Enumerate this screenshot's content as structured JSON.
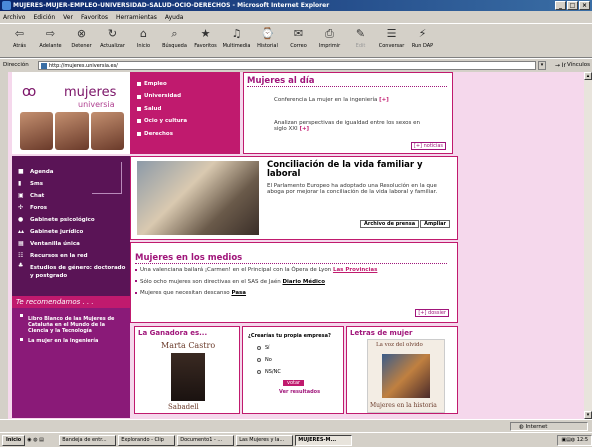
{
  "window": {
    "title": "MUJERES-MUJER-EMPLEO-UNIVERSIDAD-SALUD-OCIO-DERECHOS - Microsoft Internet Explorer"
  },
  "menu": [
    "Archivo",
    "Edición",
    "Ver",
    "Favoritos",
    "Herramientas",
    "Ayuda"
  ],
  "toolbar": [
    {
      "label": "Atrás",
      "icon": "back-arrow-icon"
    },
    {
      "label": "Adelante",
      "icon": "forward-arrow-icon"
    },
    {
      "label": "Detener",
      "icon": "stop-icon"
    },
    {
      "label": "Actualizar",
      "icon": "refresh-icon"
    },
    {
      "label": "Inicio",
      "icon": "home-icon"
    },
    {
      "label": "Búsqueda",
      "icon": "search-icon"
    },
    {
      "label": "Favoritos",
      "icon": "favorites-icon"
    },
    {
      "label": "Multimedia",
      "icon": "media-icon"
    },
    {
      "label": "Historial",
      "icon": "history-icon"
    },
    {
      "label": "Correo",
      "icon": "mail-icon"
    },
    {
      "label": "Imprimir",
      "icon": "print-icon"
    },
    {
      "label": "Edit",
      "icon": "edit-icon"
    },
    {
      "label": "Conversar",
      "icon": "discuss-icon"
    },
    {
      "label": "Run DAP",
      "icon": "dap-icon"
    }
  ],
  "address": {
    "label": "Dirección",
    "url": "http://mujeres.universia.es/",
    "go": "Ir",
    "links": "Vínculos"
  },
  "site": {
    "logo_text": "mujeres",
    "logo_sub": "universia",
    "top_nav": [
      "Empleo",
      "Universidad",
      "Salud",
      "Ocio y cultura",
      "Derechos"
    ],
    "dia": {
      "title": "Mujeres al día",
      "item1": "Conferencia La mujer en la ingeniería",
      "item1_more": "[+]",
      "item2": "Analizan perspectivas de igualdad entre los sexos en siglo XXI",
      "item2_more": "[+]",
      "button": "[+] noticias"
    },
    "sidebar": [
      {
        "label": "Agenda",
        "icon": "agenda-icon"
      },
      {
        "label": "Sms",
        "icon": "sms-icon"
      },
      {
        "label": "Chat",
        "icon": "chat-icon"
      },
      {
        "label": "Foros",
        "icon": "forum-icon"
      },
      {
        "label": "Gabinete psicológico",
        "icon": "psychology-icon"
      },
      {
        "label": "Gabinete jurídico",
        "icon": "legal-icon"
      },
      {
        "label": "Ventanilla única",
        "icon": "window-icon"
      },
      {
        "label": "Recursos en la red",
        "icon": "network-icon"
      },
      {
        "label": "Estudios de género: doctorado y postgrado",
        "icon": "studies-icon"
      }
    ],
    "reco": {
      "title": "Te recomendamos . . .",
      "items": [
        "Libro Blanco de las Mujeres de Cataluña en el Mundo de la Ciencia y la Tecnología",
        "La mujer en la ingeniería"
      ]
    },
    "featured": {
      "title": "Conciliación de la vida familiar y laboral",
      "text": "El Parlamento Europeo ha adoptado una Resolución en la que aboga por mejorar la conciliación de la vida laboral y familiar.",
      "btn_archive": "Archivo de prensa",
      "btn_more": "Ampliar"
    },
    "medios": {
      "title": "Mujeres en los medios",
      "items": [
        {
          "text": "Una valenciana bailará ¡Carmen! en el Principal con la Ópera de Lyon",
          "source": "Las Provincias"
        },
        {
          "text": "Sólo ocho mujeres son directivas en el SAS de Jaén",
          "source": "Diario Médico"
        },
        {
          "text": "Mujeres que necesitan descanso",
          "source": "Pasa"
        }
      ],
      "button": "[+] dossier"
    },
    "ganadora": {
      "title": "La Ganadora es...",
      "name": "Marta Castro",
      "caption": "Sabadell"
    },
    "poll": {
      "question": "¿Crearías tu propia empresa?",
      "options": [
        "Sí",
        "No",
        "NS/NC"
      ],
      "vote": "votar",
      "results": "Ver resultados"
    },
    "letras": {
      "title": "Letras de mujer",
      "book_title": "La voz del olvido",
      "book_caption": "Mujeres en la historia"
    }
  },
  "status": {
    "zone": "Internet"
  },
  "taskbar": {
    "start": "Inicio",
    "tasks": [
      "Bandeja de entr...",
      "Explorando - Clip",
      "Documento1 - ...",
      "Las Mujeres y la...",
      "MUJERES-M..."
    ],
    "time": "12:5"
  }
}
